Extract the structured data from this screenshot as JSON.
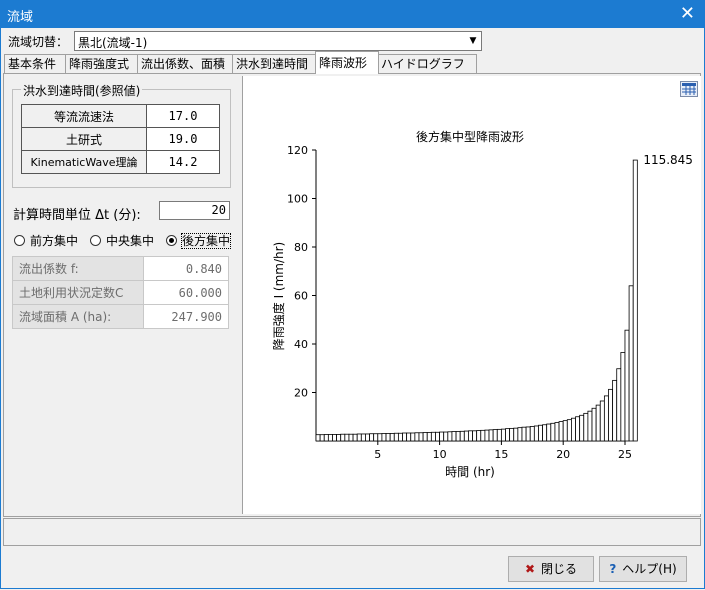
{
  "window": {
    "title": "流域",
    "close_glyph": "✕"
  },
  "basin": {
    "label": "流域切替：",
    "selected": "黒北(流域-1)"
  },
  "tabs": [
    "基本条件",
    "降雨強度式",
    "流出係数、面積",
    "洪水到達時間",
    "降雨波形",
    "ハイドログラフ"
  ],
  "active_tab": "降雨波形",
  "arrival": {
    "caption": "洪水到達時間(参照値)",
    "rows": [
      {
        "label": "等流流速法",
        "value": "17.0"
      },
      {
        "label": "土研式",
        "value": "19.0"
      },
      {
        "label": "KinematicWave理論",
        "value": "14.2"
      }
    ]
  },
  "dt": {
    "label": "計算時間単位 Δt (分):",
    "value": "20"
  },
  "radios": [
    {
      "label": "前方集中",
      "checked": false
    },
    {
      "label": "中央集中",
      "checked": false
    },
    {
      "label": "後方集中",
      "checked": true
    }
  ],
  "params": [
    {
      "label": "流出係数 f:",
      "value": "0.840"
    },
    {
      "label": "土地利用状況定数C",
      "value": "60.000"
    },
    {
      "label": "流域面積 A (ha):",
      "value": "247.900"
    }
  ],
  "icons": {
    "grid": "grid-icon",
    "close_btn": "x-icon",
    "help_btn": "question-icon"
  },
  "buttons": {
    "close": "閉じる",
    "help": "ヘルプ(H)"
  },
  "colors": {
    "titlebar": "#1c7bd1",
    "close_icon": "#b01818",
    "help_icon": "#1a5fb4"
  },
  "chart_data": {
    "type": "bar",
    "title": "後方集中型降雨波形",
    "xlabel": "時間 (hr)",
    "ylabel": "降雨強度 I (mm/hr)",
    "xlim": [
      0,
      25
    ],
    "ylim": [
      0,
      120
    ],
    "xticks": [
      5,
      10,
      15,
      20,
      25
    ],
    "yticks": [
      20,
      40,
      60,
      80,
      100,
      120
    ],
    "bar_width_hr": 0.3333,
    "max_label": "115.845",
    "values": [
      2.6,
      2.6,
      2.7,
      2.7,
      2.7,
      2.7,
      2.8,
      2.8,
      2.8,
      2.8,
      2.9,
      2.9,
      2.9,
      3.0,
      3.0,
      3.0,
      3.1,
      3.1,
      3.1,
      3.2,
      3.2,
      3.3,
      3.3,
      3.3,
      3.4,
      3.4,
      3.5,
      3.5,
      3.6,
      3.6,
      3.7,
      3.7,
      3.8,
      3.9,
      3.9,
      4.0,
      4.1,
      4.2,
      4.2,
      4.3,
      4.4,
      4.5,
      4.6,
      4.7,
      4.8,
      4.9,
      5.1,
      5.2,
      5.3,
      5.5,
      5.7,
      5.8,
      6.0,
      6.2,
      6.5,
      6.7,
      7.0,
      7.3,
      7.6,
      8.0,
      8.4,
      8.8,
      9.4,
      10.0,
      10.6,
      11.4,
      12.3,
      13.5,
      14.8,
      16.5,
      18.6,
      21.3,
      25.0,
      29.8,
      36.5,
      45.7,
      64.0,
      115.845
    ]
  }
}
